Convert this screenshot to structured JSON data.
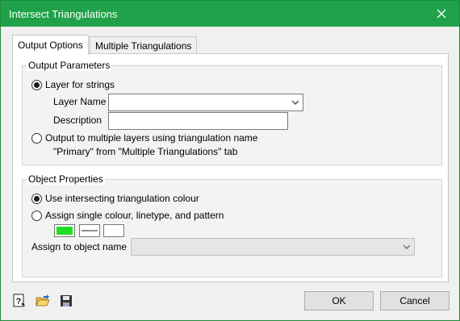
{
  "window": {
    "title": "Intersect Triangulations"
  },
  "tabs": [
    {
      "label": "Output Options",
      "active": true
    },
    {
      "label": "Multiple Triangulations",
      "active": false
    }
  ],
  "output_parameters": {
    "title": "Output Parameters",
    "layer_for_strings_label": "Layer for strings",
    "layer_for_strings_checked": true,
    "layer_name_label": "Layer Name",
    "layer_name_value": "",
    "description_label": "Description",
    "description_value": "",
    "multiple_layers_label": "Output to multiple layers using triangulation name",
    "multiple_layers_checked": false,
    "multiple_layers_note": "\"Primary\" from \"Multiple Triangulations\" tab"
  },
  "object_properties": {
    "title": "Object Properties",
    "use_intersecting_label": "Use intersecting triangulation colour",
    "use_intersecting_checked": true,
    "assign_single_label": "Assign single colour, linetype, and pattern",
    "assign_single_checked": false,
    "colour_swatch": "#22dd22",
    "assign_object_name_label": "Assign to object name",
    "assign_object_name_value": ""
  },
  "toolbar": {
    "icons": [
      "help-icon",
      "open-folder-icon",
      "save-icon"
    ]
  },
  "buttons": {
    "ok": "OK",
    "cancel": "Cancel"
  },
  "colors": {
    "titlebar": "#1fa24a",
    "accent_green": "#22dd22"
  }
}
